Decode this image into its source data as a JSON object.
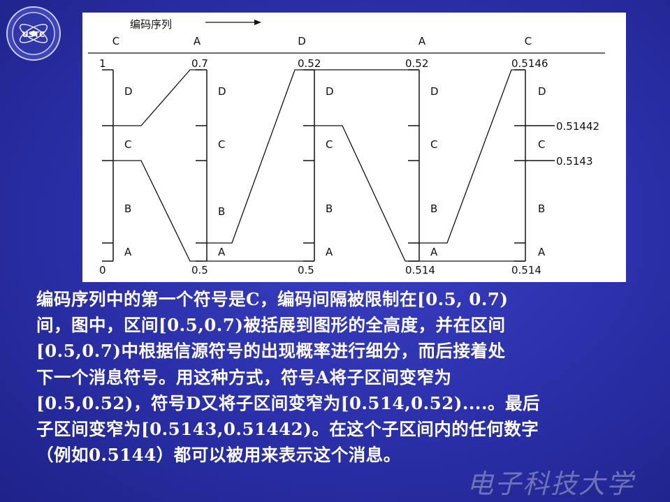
{
  "logo": {
    "text": "USTC"
  },
  "diagram": {
    "sequence_label": "编码序列",
    "symbols": [
      "C",
      "A",
      "D",
      "A",
      "C"
    ],
    "columns": [
      {
        "top": "1",
        "bottom": "0",
        "labels": [
          "D",
          "C",
          "B",
          "A"
        ]
      },
      {
        "top": "0.7",
        "bottom": "0.5",
        "labels": [
          "D",
          "C",
          "B",
          "A"
        ]
      },
      {
        "top": "0.52",
        "bottom": "0.5",
        "labels": [
          "D",
          "C",
          "B",
          "A"
        ]
      },
      {
        "top": "0.52",
        "bottom": "0.514",
        "labels": [
          "D",
          "C",
          "B",
          "A"
        ]
      },
      {
        "top": "0.5146",
        "bottom": "0.514",
        "labels": [
          "D",
          "C",
          "B",
          "A"
        ]
      }
    ],
    "final_marks": [
      "0.51442",
      "0.5143"
    ]
  },
  "caption": {
    "lines": [
      "编码序列中的第一个符号是C，编码间隔被限制在[0.5, 0.7)",
      "间，图中，区间[0.5,0.7)被括展到图形的全高度，并在区间",
      "[0.5,0.7)中根据信源符号的出现概率进行细分，而后接着处",
      "下一个消息符号。用这种方式，符号A将子区间变窄为",
      "[0.5,0.52)，符号D又将子区间变窄为[0.514,0.52)....。最后",
      "子区间变窄为[0.5143,0.51442)。在这个子区间内的任何数字",
      "（例如0.5144）都可以被用来表示这个消息。"
    ]
  },
  "watermark": "电子科技大学"
}
